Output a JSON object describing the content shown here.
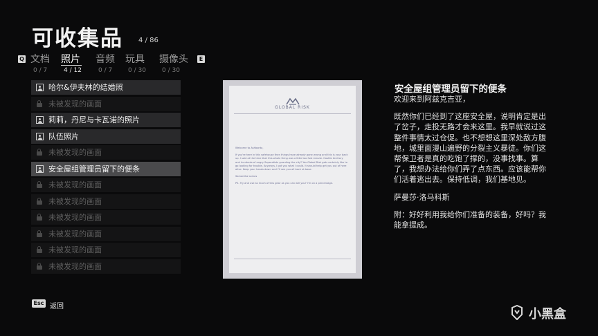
{
  "header": {
    "title": "可收集品",
    "count": "4 / 86"
  },
  "keys": {
    "prev": "Q",
    "next": "E",
    "back": "Esc"
  },
  "tabs": [
    {
      "label": "文档",
      "count": "0 / 7"
    },
    {
      "label": "照片",
      "count": "4 / 12"
    },
    {
      "label": "音频",
      "count": "0 / 7"
    },
    {
      "label": "玩具",
      "count": "0 / 30"
    },
    {
      "label": "摄像头",
      "count": "0 / 30"
    }
  ],
  "list": [
    {
      "label": "哈尔&伊夫林的结婚照",
      "state": "found"
    },
    {
      "label": "未被发现的画面",
      "state": "locked"
    },
    {
      "label": "莉莉，丹尼与卡瓦诺的照片",
      "state": "found"
    },
    {
      "label": "队伍照片",
      "state": "found"
    },
    {
      "label": "未被发现的画面",
      "state": "locked"
    },
    {
      "label": "安全屋组管理员留下的便条",
      "state": "selected"
    },
    {
      "label": "未被发现的画面",
      "state": "locked"
    },
    {
      "label": "未被发现的画面",
      "state": "locked"
    },
    {
      "label": "未被发现的画面",
      "state": "locked"
    },
    {
      "label": "未被发现的画面",
      "state": "locked"
    },
    {
      "label": "未被发现的画面",
      "state": "locked"
    },
    {
      "label": "未被发现的画面",
      "state": "locked"
    }
  ],
  "letter": {
    "brand": "GLOBAL RISK",
    "greeting": "Welcome to Ashborda,",
    "body": "If you're here in this safehouse then things have already gone wrong and this is your back up. I said at the time that this whole thing was a little too fast minute. Hostile territory and hundreds of angry Separatists guarding the city? Yes Global Risk gets certainly like to go looking for trouble. Anyways, I got you what I could. It should help get you out of here alive. Keep your heads down and I'll see you all back at base.",
    "signature": "Samantha Lomas",
    "ps": "PS. Try and use as much of this gear as you can will you? I'm on a percentage."
  },
  "detail": {
    "title": "安全屋组管理员留下的便条",
    "paragraphs": [
      "欢迎来到阿兹克吉亚，",
      "既然你们已经到了这座安全屋，说明肯定是出了岔子，走投无路才会来这里。我早就说过这整件事情太过仓促。也不想想这里深处敌方腹地，城里面漫山遍野的分裂主义暴徒。你们这帮保卫者是真的吃饱了撑的，没事找事。算了，我想办法给你们弄了点东西。应该能帮你们活着逃出去。保持低调，我们基地见。",
      "萨曼莎·洛马科斯",
      "附：好好利用我给你们准备的装备，好吗？我能拿提成。"
    ]
  },
  "footer": {
    "back_label": "返回"
  },
  "watermark": {
    "text": "小黑盒"
  },
  "colors": {
    "background": "#0a0a0b",
    "selected_row": "#4a4a4c",
    "found_row": "#29292b",
    "letter_ink": "#6d6f95"
  }
}
